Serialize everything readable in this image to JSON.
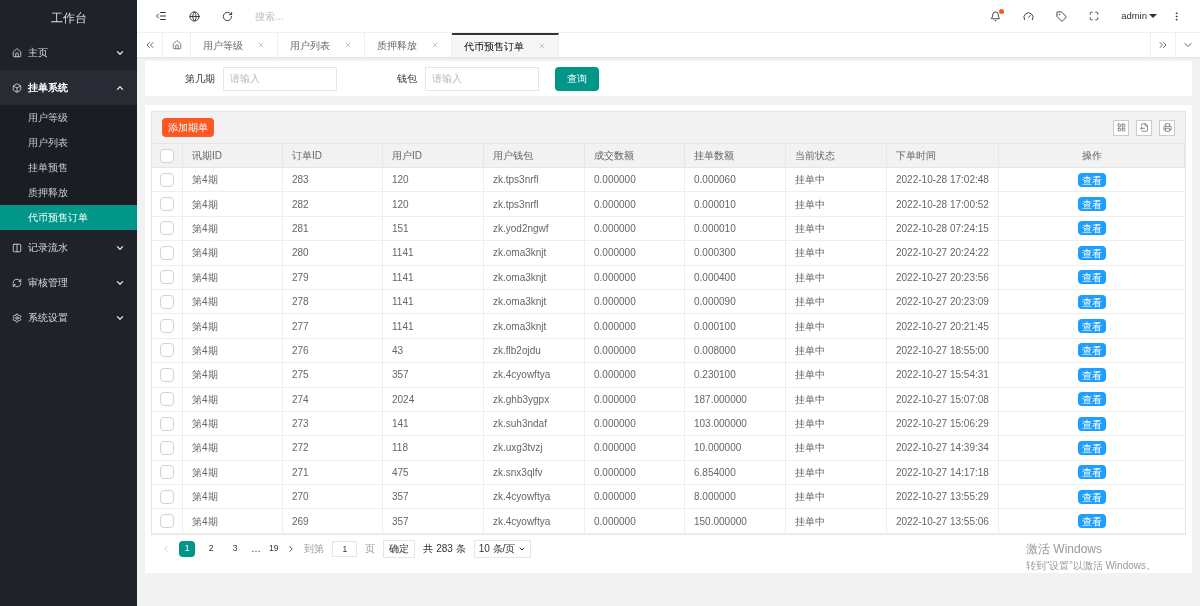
{
  "sidebar": {
    "title": "工作台",
    "items": [
      {
        "label": "主页",
        "expanded": false
      },
      {
        "label": "挂单系统",
        "expanded": true,
        "children": [
          {
            "label": "用户等级",
            "selected": false
          },
          {
            "label": "用户列表",
            "selected": false
          },
          {
            "label": "挂单预售",
            "selected": false
          },
          {
            "label": "质押释放",
            "selected": false
          },
          {
            "label": "代币预售订单",
            "selected": true
          }
        ]
      },
      {
        "label": "记录流水",
        "expanded": false
      },
      {
        "label": "审核管理",
        "expanded": false
      },
      {
        "label": "系统设置",
        "expanded": false
      }
    ]
  },
  "header": {
    "search_placeholder": "搜索...",
    "user": "admin",
    "notification": true
  },
  "tabs": [
    {
      "label": "用户等级",
      "selected": false
    },
    {
      "label": "用户列表",
      "selected": false
    },
    {
      "label": "质押释放",
      "selected": false
    },
    {
      "label": "代币预售订单",
      "selected": true
    }
  ],
  "filters": [
    {
      "label": "第几期",
      "placeholder": "请输入"
    },
    {
      "label": "钱包",
      "placeholder": "请输入"
    }
  ],
  "query_button": "查询",
  "add_button": "添加期单",
  "table": {
    "all_checked": false,
    "columns": [
      "讯期ID",
      "订单ID",
      "用户ID",
      "用户钱包",
      "成交数额",
      "挂单数额",
      "当前状态",
      "下单时间",
      "操作"
    ],
    "rows": [
      {
        "cells": [
          "第4期",
          "283",
          "120",
          "zk.tps3nrfl",
          "0.000000",
          "0.000060",
          "挂单中",
          "2022-10-28 17:02:48"
        ],
        "action": "查看",
        "checked": false
      },
      {
        "cells": [
          "第4期",
          "282",
          "120",
          "zk.tps3nrfl",
          "0.000000",
          "0.000010",
          "挂单中",
          "2022-10-28 17:00:52"
        ],
        "action": "查看",
        "checked": false
      },
      {
        "cells": [
          "第4期",
          "281",
          "151",
          "zk.yod2ngwf",
          "0.000000",
          "0.000010",
          "挂单中",
          "2022-10-28 07:24:15"
        ],
        "action": "查看",
        "checked": false
      },
      {
        "cells": [
          "第4期",
          "280",
          "1141",
          "zk.oma3knjt",
          "0.000000",
          "0.000300",
          "挂单中",
          "2022-10-27 20:24:22"
        ],
        "action": "查看",
        "checked": false
      },
      {
        "cells": [
          "第4期",
          "279",
          "1141",
          "zk.oma3knjt",
          "0.000000",
          "0.000400",
          "挂单中",
          "2022-10-27 20:23:56"
        ],
        "action": "查看",
        "checked": false
      },
      {
        "cells": [
          "第4期",
          "278",
          "1141",
          "zk.oma3knjt",
          "0.000000",
          "0.000090",
          "挂单中",
          "2022-10-27 20:23:09"
        ],
        "action": "查看",
        "checked": false
      },
      {
        "cells": [
          "第4期",
          "277",
          "1141",
          "zk.oma3knjt",
          "0.000000",
          "0.000100",
          "挂单中",
          "2022-10-27 20:21:45"
        ],
        "action": "查看",
        "checked": false
      },
      {
        "cells": [
          "第4期",
          "276",
          "43",
          "zk.flb2ojdu",
          "0.000000",
          "0.008000",
          "挂单中",
          "2022-10-27 18:55:00"
        ],
        "action": "查看",
        "checked": false
      },
      {
        "cells": [
          "第4期",
          "275",
          "357",
          "zk.4cyowftya",
          "0.000000",
          "0.230100",
          "挂单中",
          "2022-10-27 15:54:31"
        ],
        "action": "查看",
        "checked": false
      },
      {
        "cells": [
          "第4期",
          "274",
          "2024",
          "zk.ghb3ygpx",
          "0.000000",
          "187.000000",
          "挂单中",
          "2022-10-27 15:07:08"
        ],
        "action": "查看",
        "checked": false
      },
      {
        "cells": [
          "第4期",
          "273",
          "141",
          "zk.suh3ndaf",
          "0.000000",
          "103.000000",
          "挂单中",
          "2022-10-27 15:06:29"
        ],
        "action": "查看",
        "checked": false
      },
      {
        "cells": [
          "第4期",
          "272",
          "118",
          "zk.uxg3tvzj",
          "0.000000",
          "10.000000",
          "挂单中",
          "2022-10-27 14:39:34"
        ],
        "action": "查看",
        "checked": false
      },
      {
        "cells": [
          "第4期",
          "271",
          "475",
          "zk.snx3qlfv",
          "0.000000",
          "6.854000",
          "挂单中",
          "2022-10-27 14:17:18"
        ],
        "action": "查看",
        "checked": false
      },
      {
        "cells": [
          "第4期",
          "270",
          "357",
          "zk.4cyowftya",
          "0.000000",
          "8.000000",
          "挂单中",
          "2022-10-27 13:55:29"
        ],
        "action": "查看",
        "checked": false
      },
      {
        "cells": [
          "第4期",
          "269",
          "357",
          "zk.4cyowftya",
          "0.000000",
          "150.000000",
          "挂单中",
          "2022-10-27 13:55:06"
        ],
        "action": "查看",
        "checked": false
      }
    ]
  },
  "pagination": {
    "pages": [
      {
        "label": "1",
        "selected": true
      },
      {
        "label": "2",
        "selected": false
      },
      {
        "label": "3",
        "selected": false
      }
    ],
    "ellipsis": "…",
    "last": "19",
    "goto_label": "到第",
    "goto_value": "1",
    "page_unit": "页",
    "confirm": "确定",
    "total": "共 283 条",
    "page_size": "10 条/页"
  },
  "activation": {
    "title": "激活 Windows",
    "text": "转到“设置”以激活 Windows。"
  }
}
